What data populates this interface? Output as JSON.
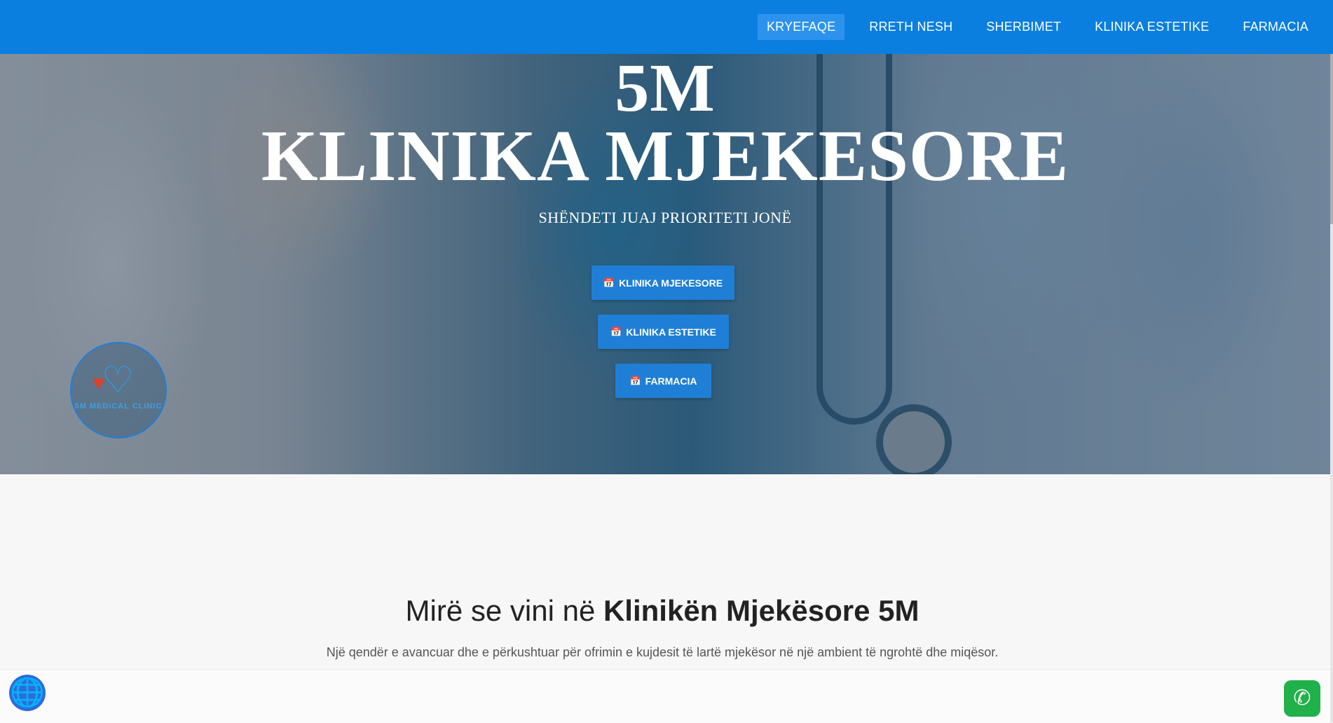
{
  "nav": {
    "items": [
      {
        "label": "KRYEFAQE",
        "active": true
      },
      {
        "label": "RRETH NESH",
        "active": false
      },
      {
        "label": "SHERBIMET",
        "active": false
      },
      {
        "label": "KLINIKA ESTETIKE",
        "active": false
      },
      {
        "label": "FARMACIA",
        "active": false
      }
    ]
  },
  "hero": {
    "title_small": "5M",
    "title_main": "KLINIKA MJEKESORE",
    "tagline": "SHËNDETI JUAJ PRIORITETI JONË",
    "buttons": [
      {
        "label": "KLINIKA MJEKESORE",
        "icon": "calendar-plus-icon"
      },
      {
        "label": "KLINIKA ESTETIKE",
        "icon": "calendar-plus-icon"
      },
      {
        "label": "FARMACIA",
        "icon": "calendar-plus-icon"
      }
    ],
    "logo_text": "5M MEDICAL CLINIC"
  },
  "welcome": {
    "title_prefix": "Mirë se vini në ",
    "title_bold": "Klinikën Mjekësore 5M",
    "description": "Një qendër e avancuar dhe e përkushtuar për ofrimin e kujdesit të lartë mjekësor në një ambient të ngrohtë dhe miqësor."
  },
  "widgets": {
    "language_icon": "globe-icon",
    "chat_icon": "whatsapp-icon"
  },
  "colors": {
    "nav_bg": "#0a7fe0",
    "nav_active": "#2b93ee",
    "button_bg": "#1f7fd6",
    "whatsapp": "#21b14a"
  }
}
